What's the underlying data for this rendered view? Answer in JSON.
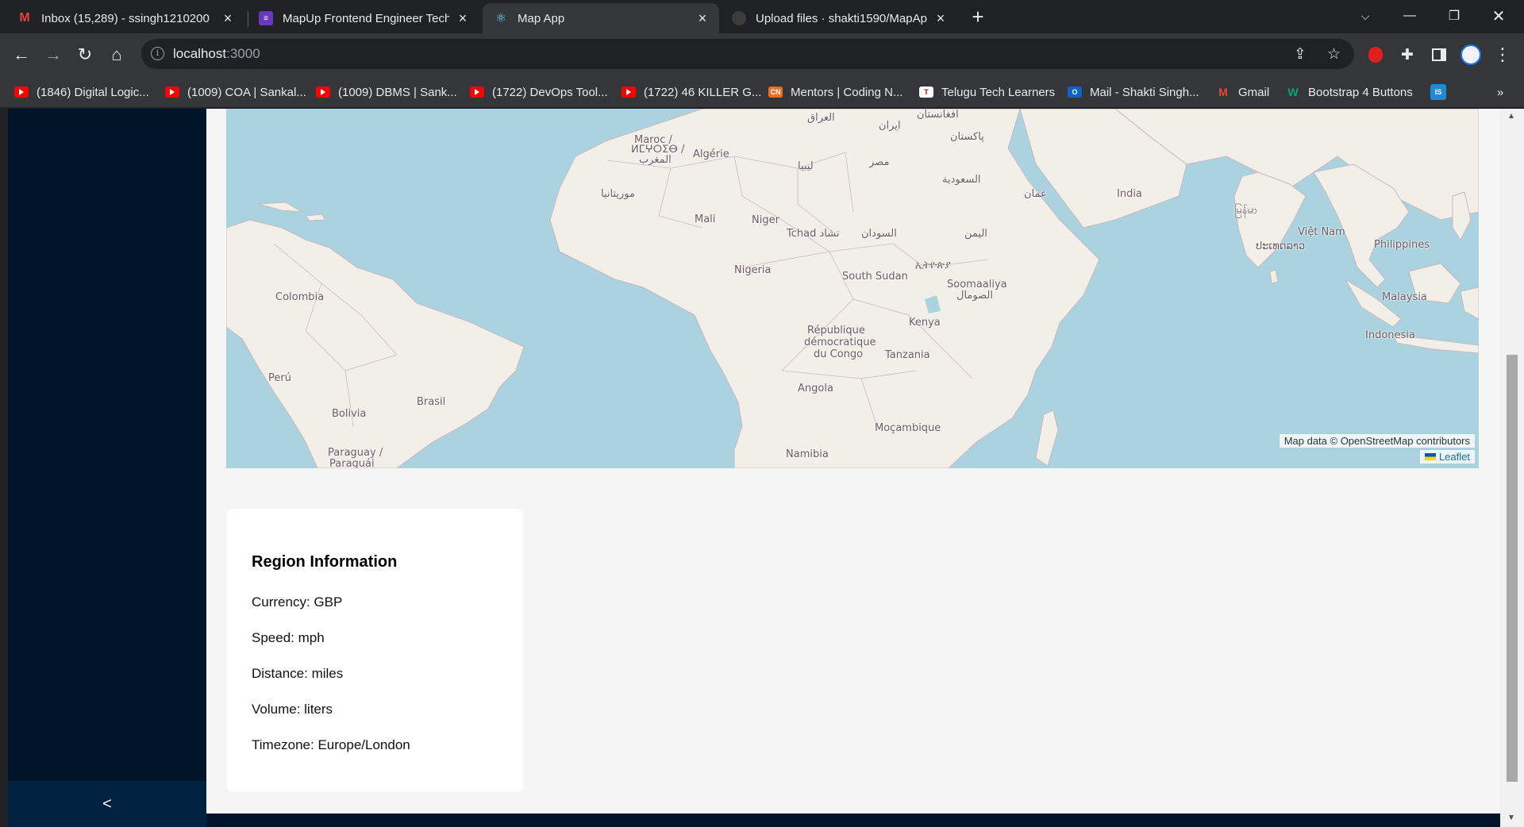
{
  "browser": {
    "tabs": [
      {
        "title": "Inbox (15,289) - ssingh1210200",
        "icon": "gmail-icon"
      },
      {
        "title": "MapUp Frontend Engineer Techn",
        "icon": "forms-icon"
      },
      {
        "title": "Map App",
        "icon": "react-icon",
        "active": true
      },
      {
        "title": "Upload files · shakti1590/MapAp",
        "icon": "github-icon"
      }
    ],
    "address": {
      "host": "localhost",
      "port": ":3000"
    },
    "bookmarks": [
      {
        "label": "(1846) Digital Logic...",
        "icon": "youtube-icon"
      },
      {
        "label": "(1009) COA | Sankal...",
        "icon": "youtube-icon"
      },
      {
        "label": "(1009) DBMS | Sank...",
        "icon": "youtube-icon"
      },
      {
        "label": "(1722) DevOps Tool...",
        "icon": "youtube-icon"
      },
      {
        "label": "(1722) 46 KILLER G...",
        "icon": "youtube-icon"
      },
      {
        "label": "Mentors | Coding N...",
        "icon": "coding-ninjas-icon"
      },
      {
        "label": "Telugu Tech Learners",
        "icon": "site-icon"
      },
      {
        "label": "Mail - Shakti Singh...",
        "icon": "outlook-icon"
      },
      {
        "label": "Gmail",
        "icon": "gmail-icon"
      },
      {
        "label": "Bootstrap 4 Buttons",
        "icon": "w3-icon"
      }
    ],
    "bookmark_overflow": "»"
  },
  "map": {
    "labels": {
      "iraq": "العراق",
      "iran": "ایران",
      "afghanistan": "افغانستان",
      "pakistan": "پاکستان",
      "maroc1": "Maroc /",
      "maroc2": "ⵍⵎⵖⵔⵉⴱ /",
      "maroc3": "المغرب",
      "algerie": "Algérie",
      "libya": "ليبيا",
      "egypt": "مصر",
      "saudi": "السعودية",
      "oman": "عمان",
      "india": "India",
      "myanmar": "မြန်မာ",
      "mauritania": "موريتانيا",
      "mali": "Mali",
      "niger": "Niger",
      "tchad": "Tchad تشاد",
      "sudan": "السودان",
      "yemen": "اليمن",
      "vietnam": "Việt Nam",
      "laos": "ປະເທດລາວ",
      "philippines": "Philippines",
      "nigeria": "Nigeria",
      "ethiopia": "ኢትዮጵያ",
      "southsudan": "South Sudan",
      "somalia1": "Soomaaliya",
      "somalia2": "الصومال",
      "colombia": "Colombia",
      "malaysia": "Malaysia",
      "kenya": "Kenya",
      "drc1": "République",
      "drc2": "démocratique",
      "drc3": "du Congo",
      "indonesia": "Indonesia",
      "tanzania": "Tanzania",
      "peru": "Perú",
      "brasil": "Brasil",
      "bolivia": "Bolivia",
      "angola": "Angola",
      "mozambique": "Moçambique",
      "paraguay1": "Paraguay /",
      "paraguay2": "Paraguái",
      "namibia": "Namibia"
    },
    "attribution": "Map data © OpenStreetMap contributors",
    "leaflet": "Leaflet"
  },
  "region": {
    "title": "Region Information",
    "currency": "Currency: GBP",
    "speed": "Speed: mph",
    "distance": "Distance: miles",
    "volume": "Volume: liters",
    "timezone": "Timezone: Europe/London"
  },
  "sidebar": {
    "collapse_label": "<"
  }
}
